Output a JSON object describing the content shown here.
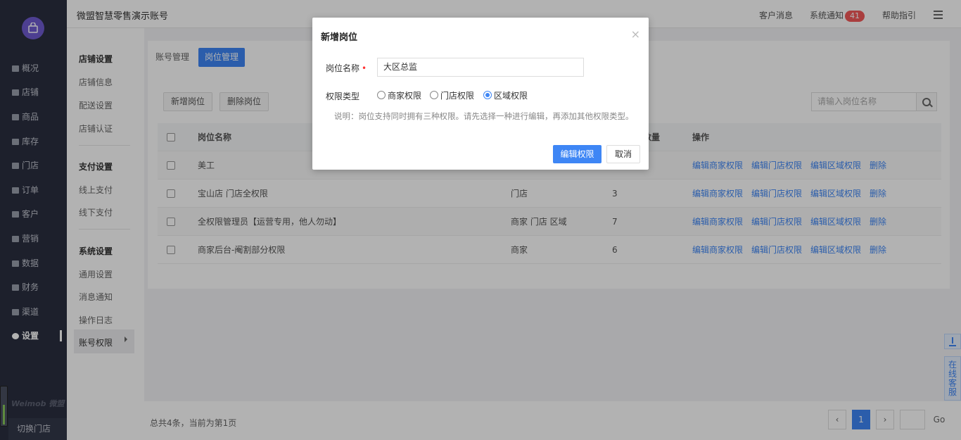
{
  "sidebar": {
    "items": [
      {
        "label": "概况"
      },
      {
        "label": "店铺"
      },
      {
        "label": "商品"
      },
      {
        "label": "库存"
      },
      {
        "label": "门店"
      },
      {
        "label": "订单"
      },
      {
        "label": "客户"
      },
      {
        "label": "营销"
      },
      {
        "label": "数据"
      },
      {
        "label": "财务"
      },
      {
        "label": "渠道"
      },
      {
        "label": "设置"
      }
    ],
    "brand": "Weimob 微盟",
    "switch_store": "切换门店"
  },
  "header": {
    "account_name": "微盟智慧零售演示账号",
    "customer_msg": "客户消息",
    "sys_notice": "系统通知",
    "notice_count": "41",
    "help": "帮助指引"
  },
  "subnav": {
    "group1_title": "店铺设置",
    "group1_items": [
      "店铺信息",
      "配送设置",
      "店铺认证"
    ],
    "group2_title": "支付设置",
    "group2_items": [
      "线上支付",
      "线下支付"
    ],
    "group3_title": "系统设置",
    "group3_items": [
      "通用设置",
      "消息通知",
      "操作日志"
    ],
    "active_item": "账号权限"
  },
  "main": {
    "tabs": [
      "账号管理",
      "岗位管理"
    ],
    "add_btn": "新增岗位",
    "delete_btn": "删除岗位",
    "search_placeholder": "请输入岗位名称",
    "columns": {
      "name": "岗位名称",
      "count": "数量",
      "ops": "操作"
    },
    "rows": [
      {
        "name": "美工",
        "type": "",
        "count": ""
      },
      {
        "name": "宝山店 门店全权限",
        "type": "门店",
        "count": "3"
      },
      {
        "name": "全权限管理员【运营专用，他人勿动】",
        "type": "商家  门店  区域",
        "count": "7"
      },
      {
        "name": "商家后台-阉割部分权限",
        "type": "商家",
        "count": "6"
      }
    ],
    "ops": [
      "编辑商家权限",
      "编辑门店权限",
      "编辑区域权限",
      "删除"
    ]
  },
  "pagination": {
    "summary": "总共4条，当前为第1页",
    "current_page": "1",
    "go_label": "Go"
  },
  "float": {
    "service_label": "在线客服"
  },
  "modal": {
    "title": "新增岗位",
    "name_label": "岗位名称",
    "name_value": "大区总监",
    "type_label": "权限类型",
    "options": [
      "商家权限",
      "门店权限",
      "区域权限"
    ],
    "selected_option": "区域权限",
    "note": "说明：岗位支持同时拥有三种权限。请先选择一种进行编辑，再添加其他权限类型。",
    "primary_btn": "编辑权限",
    "cancel_btn": "取消",
    "close_glyph": "×"
  },
  "colors": {
    "accent": "#3e86f5",
    "sidebar_bg": "#2a2f40",
    "badge": "#f25a5a"
  }
}
